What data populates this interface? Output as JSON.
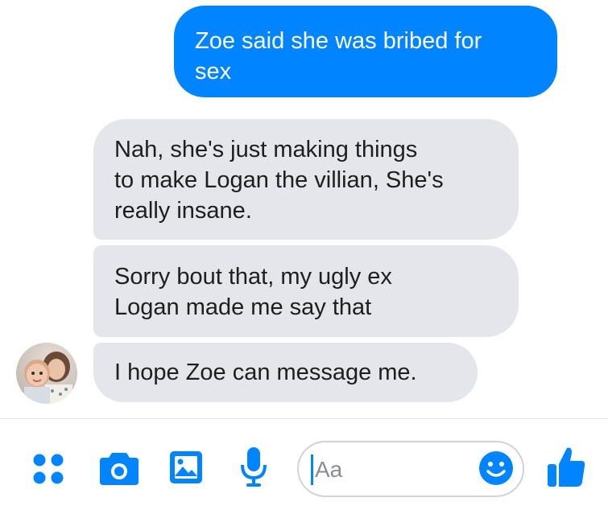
{
  "messages": {
    "sent": [
      {
        "lines": [
          "Zoe said she was bribed for",
          "sex"
        ]
      }
    ],
    "received": [
      {
        "lines": [
          "Nah, she's just making things",
          "to make Logan the villian, She's",
          "really insane."
        ]
      },
      {
        "lines": [
          "Sorry bout that, my ugly ex",
          "Logan made me say that"
        ]
      },
      {
        "lines": [
          "I hope Zoe can message me."
        ]
      }
    ]
  },
  "composer": {
    "placeholder": "Aa",
    "icons": [
      "more-icon",
      "camera-icon",
      "gallery-icon",
      "microphone-icon",
      "emoji-icon",
      "thumbs-up-icon"
    ]
  },
  "colors": {
    "accent": "#0084ff",
    "received_bubble": "#e4e6eb",
    "text": "#1c1e21"
  }
}
